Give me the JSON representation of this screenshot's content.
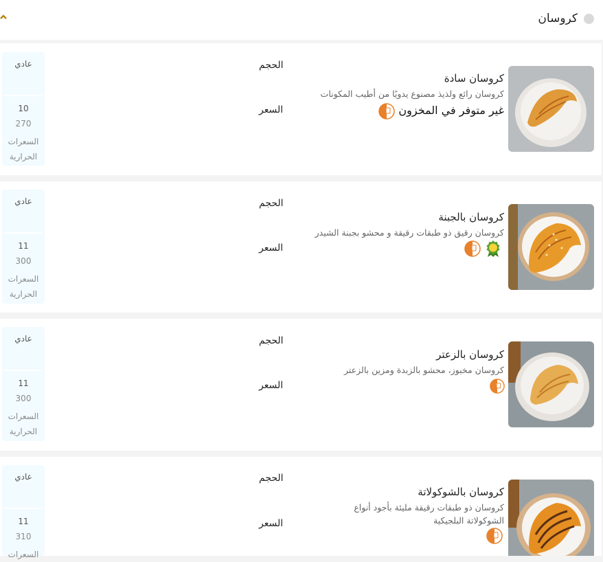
{
  "section": {
    "title": "كروسان"
  },
  "products": [
    {
      "name": "كروسان سادة",
      "description": "كروسان رائع ولذيذ مصنوع يدويًا من أطيب المكونات",
      "stock_status": "غير متوفر في المخزون",
      "size_label": "الحجم",
      "price_label": "السعر",
      "size": "عادي",
      "price": "10",
      "calories": "270",
      "calories_label": "السعرات الحرارية",
      "badges": [
        "clock-icon"
      ]
    },
    {
      "name": "كروسان بالجبنة",
      "description": "كروسان رقيق ذو طبقات رقيقة و محشو بجبنة الشيدر",
      "stock_status": "",
      "size_label": "الحجم",
      "price_label": "السعر",
      "size": "عادي",
      "price": "11",
      "calories": "300",
      "calories_label": "السعرات الحرارية",
      "badges": [
        "best-seller-icon",
        "clock-icon"
      ]
    },
    {
      "name": "كروسان بالزعتر",
      "description": "كروسان مخبوز، محشو بالزبدة ومزين بالزعتر",
      "stock_status": "",
      "size_label": "الحجم",
      "price_label": "السعر",
      "size": "عادي",
      "price": "11",
      "calories": "300",
      "calories_label": "السعرات الحرارية",
      "badges": [
        "clock-icon"
      ]
    },
    {
      "name": "كروسان بالشوكولاتة",
      "description": "كروسان ذو طبقات رقيقة مليئة بأجود أنواع الشوكولاتة البلجيكية",
      "stock_status": "",
      "size_label": "الحجم",
      "price_label": "السعر",
      "size": "عادي",
      "price": "11",
      "calories": "310",
      "calories_label": "السعرات",
      "badges": [
        "clock-icon"
      ]
    }
  ],
  "colors": {
    "accent": "#e8812a",
    "collapse": "#b8860b",
    "info_panel": "#f2fbff",
    "badge_green": "#5aa02c"
  }
}
